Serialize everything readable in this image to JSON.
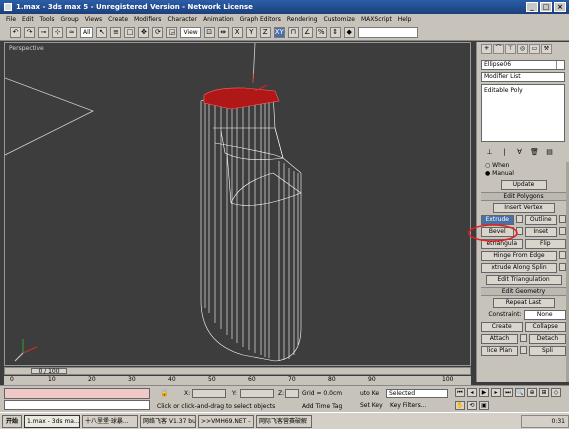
{
  "window": {
    "title": "1.max - 3ds max 5 - Unregistered Version - Network License"
  },
  "menu": [
    "File",
    "Edit",
    "Tools",
    "Group",
    "Views",
    "Create",
    "Modifiers",
    "Character",
    "Animation",
    "Graph Editors",
    "Rendering",
    "Customize",
    "MAXScript",
    "Help"
  ],
  "toolbar": {
    "selection_filter": "All",
    "view_dropdown": "View",
    "axis_x": "X",
    "axis_y": "Y",
    "axis_z": "Z",
    "axis_xy": "XY"
  },
  "viewport": {
    "label": "Perspective"
  },
  "command_panel": {
    "object_name": "Ellipse06",
    "modifier_list": "Modifier List",
    "stack_item": "Editable Poly",
    "radio_when": "When",
    "radio_manual": "Manual",
    "update_button": "Update",
    "edit_polygons_title": "Edit Polygons",
    "insert_vertex": "Insert Vertex",
    "extrude": "Extrude",
    "outline": "Outline",
    "bevel": "Bevel",
    "inset": "Inset",
    "retriangulate": "etriangula",
    "flip": "Flip",
    "hinge_from_edge": "Hinge From Edge",
    "extrude_along_spline": "xtrude Along Splin",
    "edit_triangulation": "Edit Triangulation",
    "edit_geometry_title": "Edit Geometry",
    "repeat_last": "Repeat Last",
    "constraints_label": "Constraint:",
    "constraints_value": "None",
    "create": "Create",
    "collapse": "Collapse",
    "attach": "Attach",
    "detach": "Detach",
    "slice_plane": "lice Plan",
    "split": "Spli"
  },
  "timeline": {
    "frame_display": "0 / 100"
  },
  "ruler_ticks": [
    "0",
    "10",
    "20",
    "30",
    "40",
    "50",
    "60",
    "70",
    "80",
    "90",
    "100"
  ],
  "status": {
    "prompt": "Click or click-and-drag to select objects",
    "x_label": "X:",
    "y_label": "Y:",
    "z_label": "Z:",
    "grid": "Grid = 0.0cm",
    "add_time_tag": "Add Time Tag",
    "auto_key": "uto Ke",
    "selected": "Selected",
    "set_key": "Set Key",
    "key_filters": "Key Filters..."
  },
  "taskbar": {
    "start": "开始",
    "tasks": [
      "1.max - 3ds ma...",
      "十八里堡·球暴...",
      "网络飞客 V1.37 bu...",
      ">>VMH69.NET - ...",
      "网际飞客营赛破解"
    ],
    "clock": "0:31"
  },
  "colors": {
    "viewport_bg": "#3d3d3d",
    "wire": "#ffffff",
    "selected_face": "#b01818",
    "highlight_ring": "#e02020",
    "panel_bg": "#c7c3bb"
  }
}
